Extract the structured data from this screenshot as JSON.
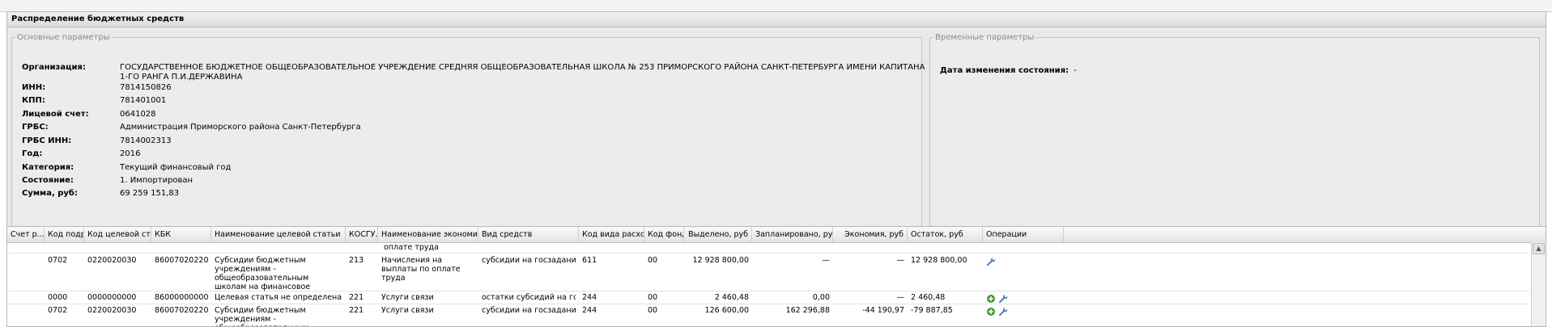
{
  "panel": {
    "title": "Распределение бюджетных средств"
  },
  "main_params": {
    "legend": "Основные параметры",
    "fields": [
      {
        "label": "Организация:",
        "value": "ГОСУДАРСТВЕННОЕ БЮДЖЕТНОЕ ОБЩЕОБРАЗОВАТЕЛЬНОЕ УЧРЕЖДЕНИЕ СРЕДНЯЯ ОБЩЕОБРАЗОВАТЕЛЬНАЯ ШКОЛА № 253 ПРИМОРСКОГО РАЙОНА САНКТ-ПЕТЕРБУРГА ИМЕНИ КАПИТАНА 1-ГО РАНГА П.И.ДЕРЖАВИНА"
      },
      {
        "label": "ИНН:",
        "value": "7814150826"
      },
      {
        "label": "КПП:",
        "value": "781401001"
      },
      {
        "label": "Лицевой счет:",
        "value": "0641028"
      },
      {
        "label": "ГРБС:",
        "value": "Администрация Приморского района Санкт-Петербурга"
      },
      {
        "label": "ГРБС ИНН:",
        "value": "7814002313"
      },
      {
        "label": "Год:",
        "value": "2016"
      },
      {
        "label": "Категория:",
        "value": "Текущий финансовый год"
      },
      {
        "label": "Состояние:",
        "value": "1. Импортирован"
      },
      {
        "label": "Сумма, руб:",
        "value": "69 259 151,83"
      }
    ]
  },
  "time_params": {
    "legend": "Временные параметры",
    "label": "Дата изменения состояния:",
    "value": "-"
  },
  "grid": {
    "columns": [
      "Счет р...",
      "Код подра...",
      "Код целевой статьи",
      "КБК",
      "Наименование целевой статьи",
      "КОСГУ...",
      "Наименование экономической ...",
      "Вид средств",
      "Код вида расходов",
      "Код фонда",
      "Выделено, руб",
      "Запланировано, руб",
      "Экономия, руб",
      "Остаток, руб",
      "Операции"
    ],
    "partial_row_text": "оплате труда",
    "rows": [
      {
        "account": "",
        "dept": "0702",
        "target": "0220020030",
        "kbk": "86007020220020...",
        "target_name": "Субсидии бюджетным учреждениям - общеобразовательным школам на финансовое обеспечение выполнения государственного задания",
        "kosgu": "213",
        "econ_name": "Начисления на выплаты по оплате труда",
        "funds": "субсидии на госзадания",
        "exp_code": "611",
        "fund_code": "00",
        "allocated": "12 928 800,00",
        "planned": "—",
        "economy": "—",
        "remainder": "12 928 800,00",
        "ops": [
          "wrench-icon"
        ]
      },
      {
        "account": "",
        "dept": "0000",
        "target": "0000000000",
        "kbk": "86000000000000...",
        "target_name": "Целевая статья не определена",
        "kosgu": "221",
        "econ_name": "Услуги связи",
        "funds": "остатки субсидий на госзадания",
        "exp_code": "244",
        "fund_code": "00",
        "allocated": "2 460,48",
        "planned": "0,00",
        "economy": "—",
        "remainder": "2 460,48",
        "ops": [
          "add-icon",
          "wrench-icon"
        ]
      },
      {
        "account": "",
        "dept": "0702",
        "target": "0220020030",
        "kbk": "86007020220020...",
        "target_name": "Субсидии бюджетным учреждениям - общеобразовательным школам на",
        "kosgu": "221",
        "econ_name": "Услуги связи",
        "funds": "субсидии на госзадания",
        "exp_code": "244",
        "fund_code": "00",
        "allocated": "126 600,00",
        "planned": "162 296,88",
        "economy": "-44 190,97",
        "remainder": "-79 887,85",
        "ops": [
          "add-icon",
          "wrench-icon"
        ]
      }
    ]
  },
  "colors": {
    "accent_green": "#3c9a2f",
    "wrench": "#4a7fb5"
  }
}
